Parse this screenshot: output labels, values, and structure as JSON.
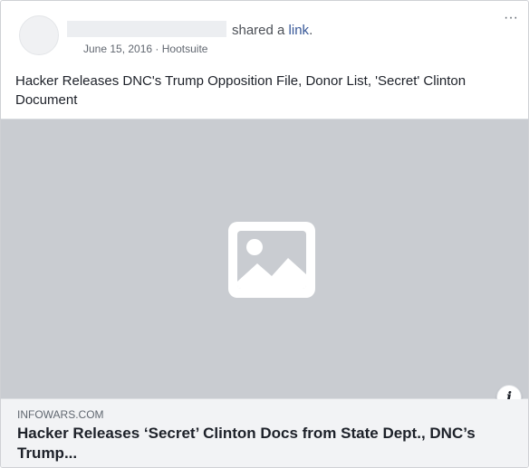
{
  "post": {
    "author_action": "shared a",
    "author_link_word": "link",
    "author_period": ".",
    "date": "June 15, 2016",
    "separator": "·",
    "source_app": "Hootsuite",
    "more_label": "···",
    "text": "Hacker Releases DNC's Trump Opposition File, Donor List, 'Secret' Clinton Document"
  },
  "link": {
    "domain": "INFOWARS.COM",
    "title": "Hacker Releases ‘Secret’ Clinton Docs from State Dept., DNC’s Trump...",
    "info_label": "i"
  },
  "icons": {
    "image_placeholder": "image-icon",
    "info": "info-icon",
    "more": "more-icon"
  },
  "colors": {
    "link_blue": "#385898",
    "image_bg": "#c9ccd1",
    "preview_bg": "#f2f3f5"
  }
}
